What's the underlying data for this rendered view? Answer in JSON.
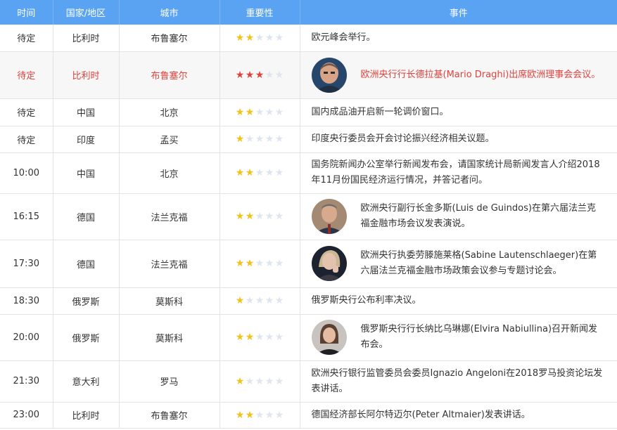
{
  "header": {
    "time": "时间",
    "country": "国家/地区",
    "city": "城市",
    "importance": "重要性",
    "event": "事件"
  },
  "colors": {
    "header_bg": "#5aa3f2",
    "highlight_text": "#e0423c",
    "star_on": "#f2c21b",
    "star_off": "#dfe5ee"
  },
  "rows": [
    {
      "time": "待定",
      "country": "比利时",
      "city": "布鲁塞尔",
      "stars": 2,
      "event": "欧元峰会举行。",
      "avatar": null,
      "highlight": false
    },
    {
      "time": "待定",
      "country": "比利时",
      "city": "布鲁塞尔",
      "stars": 3,
      "event": "欧洲央行行长德拉基(Mario Draghi)出席欧洲理事会会议。",
      "avatar": "portrait-draghi",
      "highlight": true
    },
    {
      "time": "待定",
      "country": "中国",
      "city": "北京",
      "stars": 2,
      "event": "国内成品油开启新一轮调价窗口。",
      "avatar": null,
      "highlight": false
    },
    {
      "time": "待定",
      "country": "印度",
      "city": "孟买",
      "stars": 1,
      "event": "印度央行委员会开会讨论振兴经济相关议题。",
      "avatar": null,
      "highlight": false
    },
    {
      "time": "10:00",
      "country": "中国",
      "city": "北京",
      "stars": 2,
      "event": "国务院新闻办公室举行新闻发布会，请国家统计局新闻发言人介绍2018年11月份国民经济运行情况，并答记者问。",
      "avatar": null,
      "highlight": false
    },
    {
      "time": "16:15",
      "country": "德国",
      "city": "法兰克福",
      "stars": 2,
      "event": "欧洲央行副行长金多斯(Luis de Guindos)在第六届法兰克福金融市场会议发表演说。",
      "avatar": "portrait-guindos",
      "highlight": false
    },
    {
      "time": "17:30",
      "country": "德国",
      "city": "法兰克福",
      "stars": 2,
      "event": "欧洲央行执委劳滕施莱格(Sabine Lautenschlaeger)在第六届法兰克福金融市场政策会议参与专题讨论会。",
      "avatar": "portrait-lautenschlaeger",
      "highlight": false
    },
    {
      "time": "18:30",
      "country": "俄罗斯",
      "city": "莫斯科",
      "stars": 1,
      "event": "俄罗斯央行公布利率决议。",
      "avatar": null,
      "highlight": false
    },
    {
      "time": "20:00",
      "country": "俄罗斯",
      "city": "莫斯科",
      "stars": 2,
      "event": "俄罗斯央行行长纳比乌琳娜(Elvira Nabiullina)召开新闻发布会。",
      "avatar": "portrait-nabiullina",
      "highlight": false
    },
    {
      "time": "21:30",
      "country": "意大利",
      "city": "罗马",
      "stars": 1,
      "event": "欧洲央行银行监管委员会委员Ignazio Angeloni在2018罗马投资论坛发表讲话。",
      "avatar": null,
      "highlight": false
    },
    {
      "time": "23:00",
      "country": "比利时",
      "city": "布鲁塞尔",
      "stars": 2,
      "event": "德国经济部长阿尔特迈尔(Peter Altmaier)发表讲话。",
      "avatar": null,
      "highlight": false
    }
  ]
}
